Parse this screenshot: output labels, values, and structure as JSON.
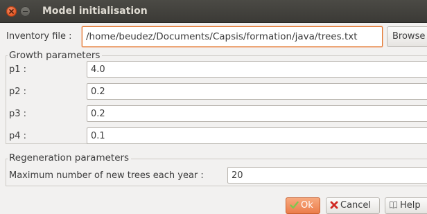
{
  "window": {
    "title": "Model initialisation"
  },
  "inventory": {
    "label": "Inventory file :",
    "value": "/home/beudez/Documents/Capsis/formation/java/trees.txt",
    "browse_label": "Browse"
  },
  "growth": {
    "legend": "Growth parameters",
    "params": [
      {
        "label": "p1 :",
        "value": "4.0"
      },
      {
        "label": "p2 :",
        "value": "0.2"
      },
      {
        "label": "p3 :",
        "value": "0.2"
      },
      {
        "label": "p4 :",
        "value": "0.1"
      }
    ]
  },
  "regeneration": {
    "legend": "Regeneration parameters",
    "label": "Maximum number of new trees each year :",
    "value": "20"
  },
  "buttons": {
    "ok": "Ok",
    "cancel": "Cancel",
    "help": "Help"
  },
  "colors": {
    "accent": "#e3762c",
    "titlebar": "#3c3b37",
    "ok_button": "#ef8656",
    "cancel_icon": "#d02722"
  },
  "icons": {
    "close": "close-icon",
    "minimize": "minimize-icon",
    "ok": "checkmark-icon",
    "cancel": "x-icon",
    "help": "book-icon"
  }
}
